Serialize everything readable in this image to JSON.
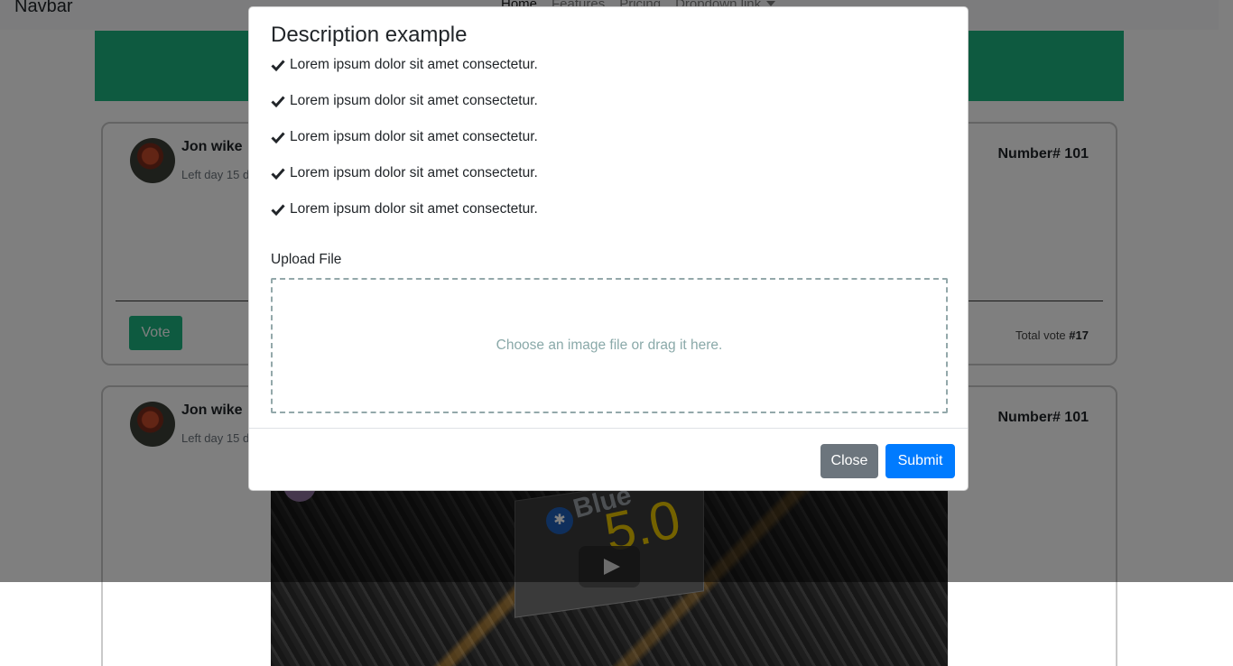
{
  "navbar": {
    "brand": "Navbar",
    "links": [
      {
        "label": "Home",
        "active": true
      },
      {
        "label": "Features"
      },
      {
        "label": "Pricing"
      },
      {
        "label": "Dropdown link"
      }
    ]
  },
  "cards": [
    {
      "author": "Jon wike",
      "meta": "Left day 15 d",
      "number": "Number# 101",
      "vote_label": "Vote",
      "total_vote_label": "Total vote",
      "total_vote_value": "#17"
    },
    {
      "author": "Jon wike",
      "meta": "Left day 15 d",
      "number": "Number# 101",
      "video": {
        "brand_text": "Blue",
        "version": "5.0",
        "icon": "bluetooth-icon"
      }
    }
  ],
  "modal": {
    "title": "Description example",
    "items": [
      "Lorem ipsum dolor sit amet consectetur.",
      "Lorem ipsum dolor sit amet consectetur.",
      "Lorem ipsum dolor sit amet consectetur.",
      "Lorem ipsum dolor sit amet consectetur.",
      "Lorem ipsum dolor sit amet consectetur."
    ],
    "upload_label": "Upload File",
    "dropzone_text": "Choose an image file or drag it here.",
    "close_label": "Close",
    "submit_label": "Submit"
  },
  "colors": {
    "accent_green": "#1db480",
    "primary_blue": "#007bff",
    "secondary_gray": "#6c757d",
    "dropzone_border": "#93a8aa"
  }
}
